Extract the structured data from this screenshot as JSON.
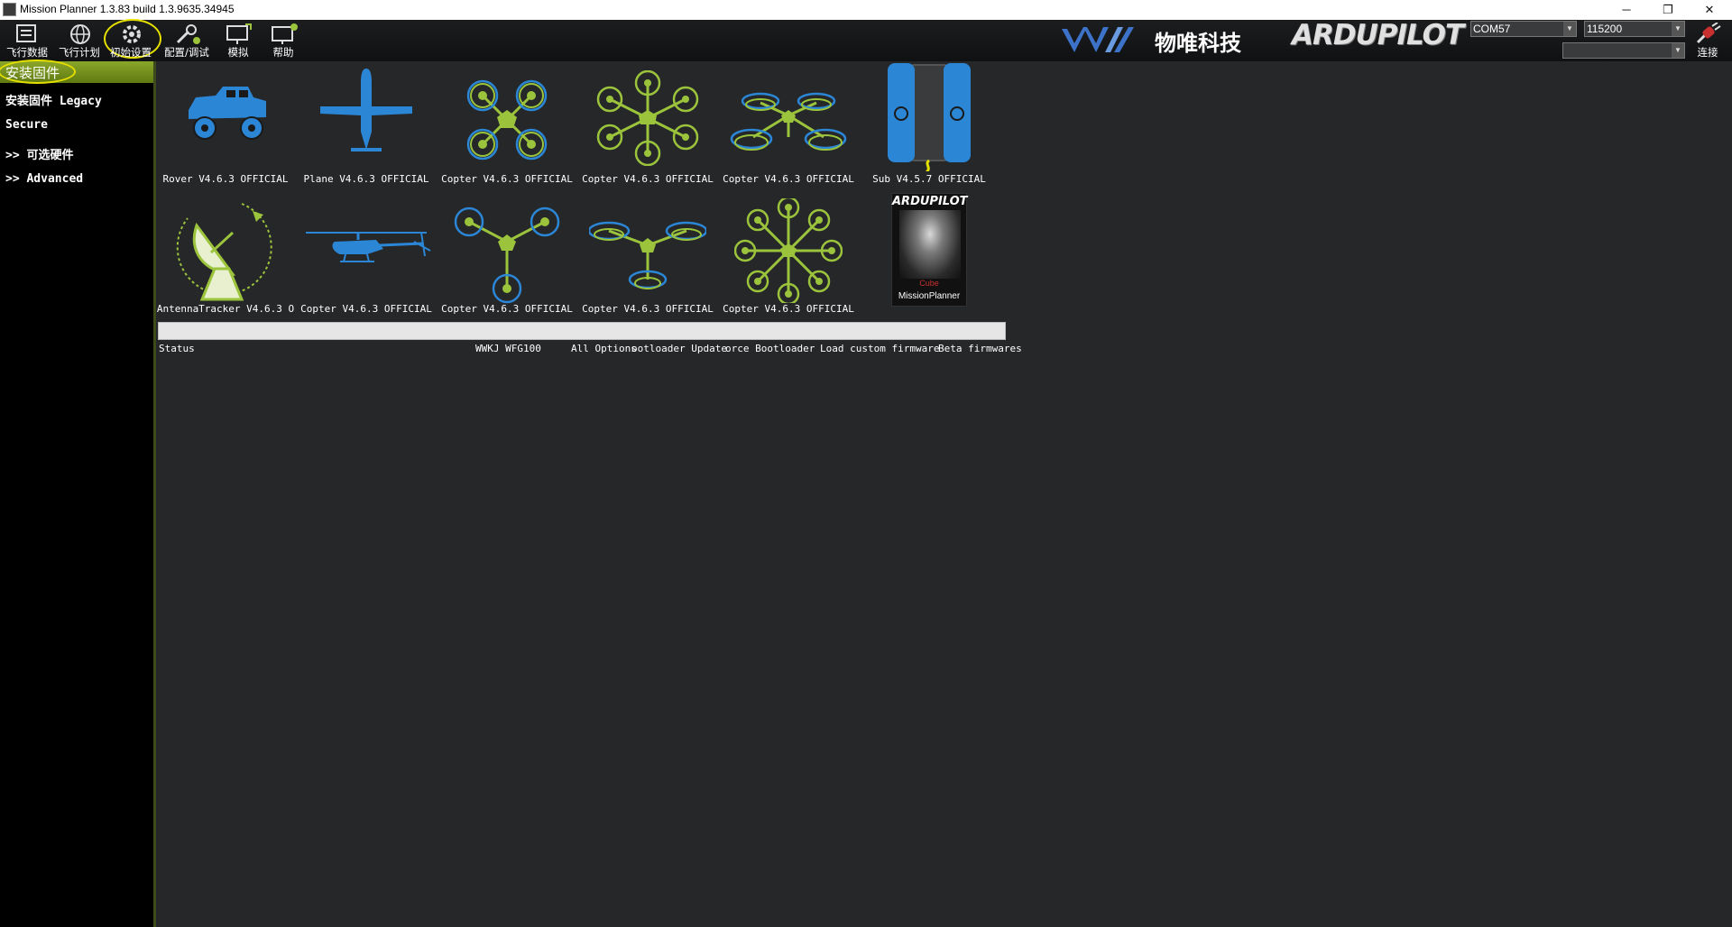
{
  "window": {
    "title": "Mission Planner 1.3.83 build 1.3.9635.34945",
    "minimize": "─",
    "restore": "❐",
    "close": "✕"
  },
  "toolbar": {
    "items": [
      {
        "label": "飞行数据",
        "icon": "flight-data-icon"
      },
      {
        "label": "飞行计划",
        "icon": "flight-plan-icon"
      },
      {
        "label": "初始设置",
        "icon": "initial-setup-icon"
      },
      {
        "label": "配置/调试",
        "icon": "config-tuning-icon"
      },
      {
        "label": "模拟",
        "icon": "simulation-icon"
      },
      {
        "label": "帮助",
        "icon": "help-icon"
      }
    ],
    "active_index": 2,
    "brand_text": "物唯科技",
    "ardupilot_logo": "ARDUPILOT",
    "com_port": "COM57",
    "baud_rate": "115200",
    "connect_label": "连接"
  },
  "sidebar": {
    "active_label": "安装固件",
    "items": [
      {
        "label": "安装固件 Legacy"
      },
      {
        "label": "Secure"
      },
      {
        "label": ">> 可选硬件"
      },
      {
        "label": ">> Advanced"
      }
    ]
  },
  "firmware": {
    "row1": [
      {
        "label": "Rover V4.6.3 OFFICIAL",
        "icon": "rover-icon"
      },
      {
        "label": "Plane V4.6.3 OFFICIAL",
        "icon": "plane-icon"
      },
      {
        "label": "Copter V4.6.3 OFFICIAL",
        "icon": "quad-x-icon"
      },
      {
        "label": "Copter V4.6.3 OFFICIAL",
        "icon": "hexa-icon"
      },
      {
        "label": "Copter V4.6.3 OFFICIAL",
        "icon": "y6-coax-icon"
      },
      {
        "label": "Sub V4.5.7 OFFICIAL",
        "icon": "sub-icon"
      }
    ],
    "row2": [
      {
        "label": "AntennaTracker  V4.6.3 O",
        "icon": "antenna-tracker-icon"
      },
      {
        "label": "Copter V4.6.3 OFFICIAL",
        "icon": "helicopter-icon"
      },
      {
        "label": "Copter V4.6.3 OFFICIAL",
        "icon": "tri-icon"
      },
      {
        "label": "Copter V4.6.3 OFFICIAL",
        "icon": "y6-icon"
      },
      {
        "label": "Copter V4.6.3 OFFICIAL",
        "icon": "octo-icon"
      },
      {
        "cube_top": "ARDUPILOT",
        "cube_mid": "Cube",
        "cube_bottom": "MissionPlanner",
        "icon": "cube-missionplanner-icon"
      }
    ]
  },
  "bottom": {
    "status": "Status",
    "board": "WWKJ WFG100",
    "all_options": "All Options",
    "bootloader_update": "ootloader Update",
    "force_bootloader": "orce Bootloader",
    "load_custom": "Load custom firmware",
    "beta": "Beta firmwares"
  },
  "colors": {
    "background": "#262729",
    "sidebar_active": "#7a9620",
    "highlight_ring": "#e6e000",
    "icon_blue": "#2b86d6",
    "icon_green": "#9bc43c"
  }
}
